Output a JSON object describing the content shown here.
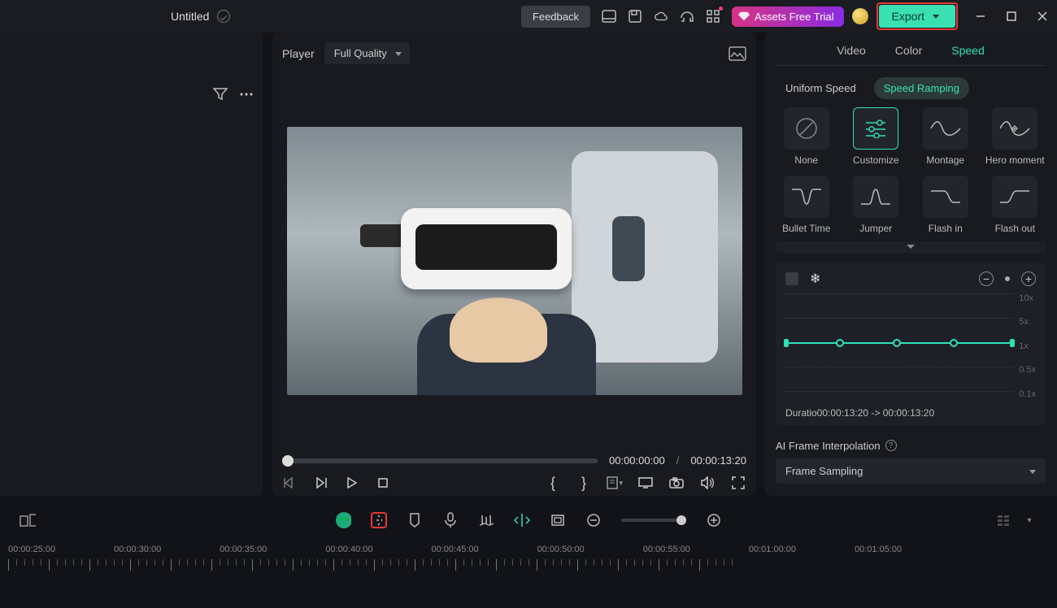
{
  "header": {
    "title": "Untitled",
    "feedback": "Feedback",
    "assets_trial": "Assets Free Trial",
    "export": "Export"
  },
  "player": {
    "label": "Player",
    "quality": "Full Quality",
    "current_tc": "00:00:00:00",
    "sep": "/",
    "duration_tc": "00:00:13:20"
  },
  "right": {
    "tabs": {
      "video": "Video",
      "color": "Color",
      "speed": "Speed"
    },
    "subtabs": {
      "uniform": "Uniform Speed",
      "ramping": "Speed Ramping"
    },
    "presets": {
      "none": "None",
      "customize": "Customize",
      "montage": "Montage",
      "hero": "Hero moment",
      "bullet": "Bullet Time",
      "jumper": "Jumper",
      "flashin": "Flash in",
      "flashout": "Flash out"
    },
    "ylabels": {
      "x10": "10x",
      "x5": "5x",
      "x1": "1x",
      "x05": "0.5x",
      "x01": "0.1x"
    },
    "duration": "Duratio00:00:13:20 -> 00:00:13:20",
    "ai_label": "AI Frame Interpolation",
    "ai_value": "Frame Sampling"
  },
  "timeline": {
    "labels": [
      "00:00:25:00",
      "00:00:30:00",
      "00:00:35:00",
      "00:00:40:00",
      "00:00:45:00",
      "00:00:50:00",
      "00:00:55:00",
      "00:01:00:00",
      "00:01:05:00"
    ]
  }
}
